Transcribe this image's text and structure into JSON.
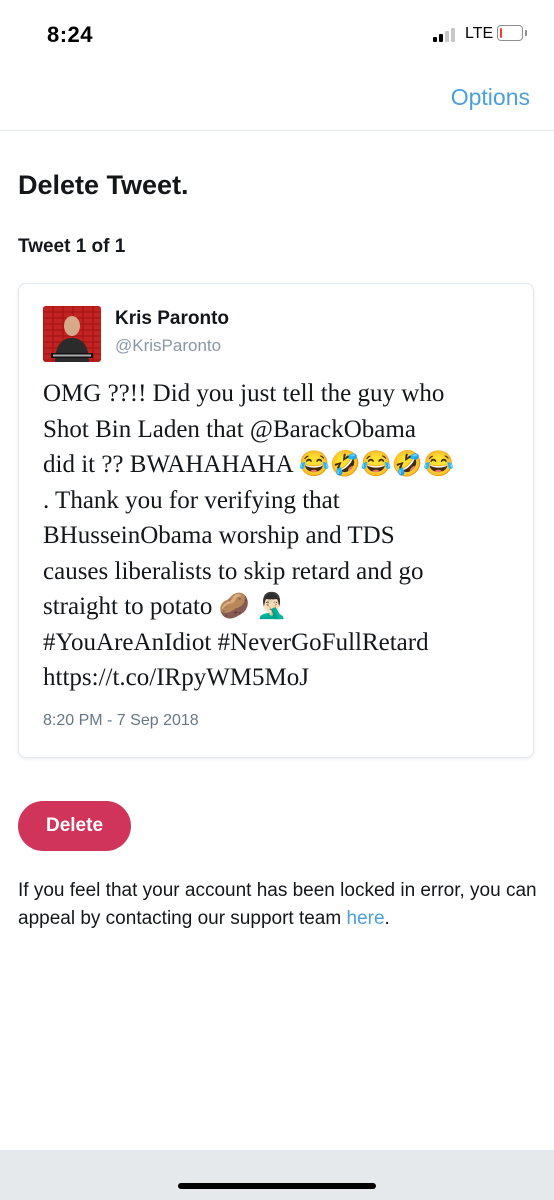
{
  "status_bar": {
    "time": "8:24",
    "network": "LTE",
    "battery_level": 0.12,
    "battery_color": "#ff3b30"
  },
  "nav": {
    "options_label": "Options"
  },
  "page": {
    "title": "Delete Tweet.",
    "counter": "Tweet 1 of 1"
  },
  "tweet": {
    "author_name": "Kris Paronto",
    "author_handle": "@KrisParonto",
    "avatar_icon": "profile-photo",
    "text": "OMG ??!! Did you just tell the guy who\nShot Bin Laden that @BarackObama\ndid it ?? BWAHAHAHA 😂🤣😂🤣😂\n. Thank you for verifying that\nBHusseinObama worship and TDS\ncauses liberalists to skip retard and go\nstraight to potato 🥔 🤦🏻‍♂️\n#YouAreAnIdiot #NeverGoFullRetard\nhttps://t.co/IRpyWM5MoJ",
    "timestamp": "8:20 PM - 7 Sep 2018"
  },
  "actions": {
    "delete_label": "Delete"
  },
  "appeal": {
    "text_before": "If you feel that your account has been locked in error, you can appeal by contacting our support team ",
    "link_text": "here",
    "text_after": "."
  },
  "colors": {
    "accent_link": "#4a9fe0",
    "delete_button": "#d0345b"
  }
}
